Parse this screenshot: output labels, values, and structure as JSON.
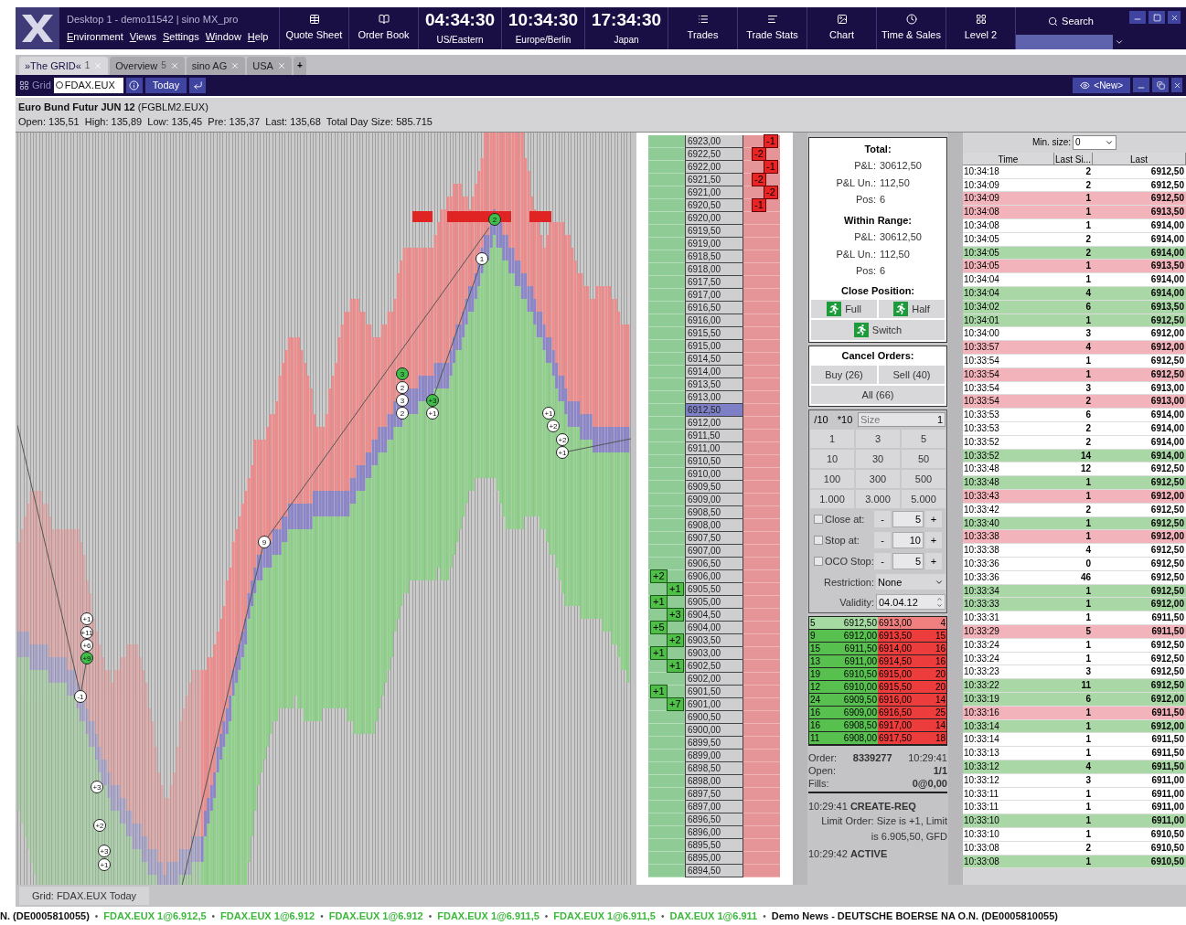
{
  "app": {
    "title": "Desktop 1 - demo11542 | sino MX_pro",
    "menu": [
      "Environment",
      "Views",
      "Settings",
      "Window",
      "Help"
    ]
  },
  "tools_left": [
    {
      "label": "Quote Sheet",
      "kind": "quote"
    },
    {
      "label": "Order Book",
      "kind": "book"
    }
  ],
  "clocks": [
    {
      "time": "04:34:30",
      "zone": "US/Eastern"
    },
    {
      "time": "10:34:30",
      "zone": "Europe/Berlin"
    },
    {
      "time": "17:34:30",
      "zone": "Japan"
    }
  ],
  "tools_right": [
    {
      "label": "Trades",
      "kind": "trades"
    },
    {
      "label": "Trade Stats",
      "kind": "stats"
    },
    {
      "label": "Chart",
      "kind": "chart"
    },
    {
      "label": "Time & Sales",
      "kind": "times"
    },
    {
      "label": "Level 2",
      "kind": "level2"
    }
  ],
  "search": {
    "label": "Search"
  },
  "tabs": [
    {
      "label": "»The GRID«",
      "count": "1",
      "selected": true
    },
    {
      "label": "Overview",
      "count": "5",
      "selected": false
    },
    {
      "label": "sino AG",
      "selected": false
    },
    {
      "label": "USA",
      "selected": false
    }
  ],
  "add_tab": "+",
  "grid_toolbar": {
    "label": "Grid",
    "symbol": "FDAX.EUX",
    "date": "Today",
    "view": "<New>"
  },
  "instrument": {
    "title": "**Euro Bund Futur JUN 12** (FGBLM2.EUX)",
    "stats": "Open: 135,51  High: 135,89  Low: 135,45  Pre: 135,37  Last: 135,68  Total Day Size: 585.715"
  },
  "chart_markers": [
    {
      "label": "2",
      "filled": true
    },
    {
      "label": "1",
      "filled": false
    },
    {
      "label": "3",
      "filled": true
    },
    {
      "label": "2",
      "filled": false
    },
    {
      "label": "3",
      "filled": false
    },
    {
      "label": "2",
      "filled": false
    },
    {
      "label": "+3",
      "filled": true
    },
    {
      "label": "+1",
      "filled": false
    },
    {
      "label": "+1",
      "filled": false
    },
    {
      "label": "+2",
      "filled": false
    },
    {
      "label": "+2",
      "filled": false
    },
    {
      "label": "+1",
      "filled": false
    },
    {
      "label": "9",
      "filled": false
    },
    {
      "label": "+1",
      "filled": false
    },
    {
      "label": "+11",
      "filled": false
    },
    {
      "label": "+6",
      "filled": false
    },
    {
      "label": "+9",
      "filled": true
    },
    {
      "label": "-1",
      "filled": false
    },
    {
      "label": "+3",
      "filled": false
    },
    {
      "label": "+2",
      "filled": false
    },
    {
      "label": "+3",
      "filled": false
    },
    {
      "label": "+1",
      "filled": false
    }
  ],
  "ladder": [
    {
      "price": "6923,00",
      "selected": false,
      "order": {
        "label": "-1",
        "kind": "sell"
      }
    },
    {
      "price": "6922,50",
      "selected": false,
      "order": {
        "label": "-2",
        "kind": "sell"
      }
    },
    {
      "price": "6922,00",
      "selected": false,
      "order": {
        "label": "-1",
        "kind": "sell"
      }
    },
    {
      "price": "6921,50",
      "selected": false,
      "order": {
        "label": "-2",
        "kind": "sell"
      }
    },
    {
      "price": "6921,00",
      "selected": false,
      "order": {
        "label": "-2",
        "kind": "sell"
      }
    },
    {
      "price": "6920,50",
      "selected": false,
      "order": {
        "label": "-1",
        "kind": "sell"
      }
    },
    {
      "price": "6920,00",
      "selected": false
    },
    {
      "price": "6919,50",
      "selected": false
    },
    {
      "price": "6919,00",
      "selected": false
    },
    {
      "price": "6918,50",
      "selected": false
    },
    {
      "price": "6918,00",
      "selected": false
    },
    {
      "price": "6917,50",
      "selected": false
    },
    {
      "price": "6917,00",
      "selected": false
    },
    {
      "price": "6916,50",
      "selected": false
    },
    {
      "price": "6916,00",
      "selected": false
    },
    {
      "price": "6915,50",
      "selected": false
    },
    {
      "price": "6915,00",
      "selected": false
    },
    {
      "price": "6914,50",
      "selected": false
    },
    {
      "price": "6914,00",
      "selected": false
    },
    {
      "price": "6913,50",
      "selected": false
    },
    {
      "price": "6913,00",
      "selected": false
    },
    {
      "price": "6912,50",
      "selected": true
    },
    {
      "price": "6912,00",
      "selected": false
    },
    {
      "price": "6911,50",
      "selected": false
    },
    {
      "price": "6911,00",
      "selected": false
    },
    {
      "price": "6910,50",
      "selected": false
    },
    {
      "price": "6910,00",
      "selected": false
    },
    {
      "price": "6909,50",
      "selected": false
    },
    {
      "price": "6909,00",
      "selected": false
    },
    {
      "price": "6908,50",
      "selected": false
    },
    {
      "price": "6908,00",
      "selected": false
    },
    {
      "price": "6907,50",
      "selected": false
    },
    {
      "price": "6907,00",
      "selected": false
    },
    {
      "price": "6906,50",
      "selected": false
    },
    {
      "price": "6906,00",
      "selected": false,
      "order": {
        "label": "+2",
        "kind": "buy"
      }
    },
    {
      "price": "6905,50",
      "selected": false,
      "order": {
        "label": "+1",
        "kind": "buy"
      }
    },
    {
      "price": "6905,00",
      "selected": false,
      "order": {
        "label": "+1",
        "kind": "buy"
      }
    },
    {
      "price": "6904,50",
      "selected": false,
      "order": {
        "label": "+3",
        "kind": "buy"
      }
    },
    {
      "price": "6904,00",
      "selected": false,
      "order": {
        "label": "+5",
        "kind": "buy"
      }
    },
    {
      "price": "6903,50",
      "selected": false,
      "order": {
        "label": "+2",
        "kind": "buy"
      }
    },
    {
      "price": "6903,00",
      "selected": false,
      "order": {
        "label": "+1",
        "kind": "buy"
      }
    },
    {
      "price": "6902,50",
      "selected": false,
      "order": {
        "label": "+1",
        "kind": "buy"
      }
    },
    {
      "price": "6902,00",
      "selected": false
    },
    {
      "price": "6901,50",
      "selected": false,
      "order": {
        "label": "+1",
        "kind": "buy"
      }
    },
    {
      "price": "6901,00",
      "selected": false,
      "order": {
        "label": "+7",
        "kind": "buy"
      }
    },
    {
      "price": "6900,50",
      "selected": false
    },
    {
      "price": "6900,00",
      "selected": false
    },
    {
      "price": "6899,50",
      "selected": false
    },
    {
      "price": "6899,00",
      "selected": false
    },
    {
      "price": "6898,50",
      "selected": false
    },
    {
      "price": "6898,00",
      "selected": false
    },
    {
      "price": "6897,50",
      "selected": false
    },
    {
      "price": "6897,00",
      "selected": false
    },
    {
      "price": "6896,50",
      "selected": false
    },
    {
      "price": "6896,00",
      "selected": false
    },
    {
      "price": "6895,50",
      "selected": false
    },
    {
      "price": "6895,00",
      "selected": false
    },
    {
      "price": "6894,50",
      "selected": false
    }
  ],
  "position": {
    "total_title": "Total:",
    "total": [
      {
        "label": "P&L:",
        "value": "30612,50"
      },
      {
        "label": "P&L Un.:",
        "value": "112,50"
      },
      {
        "label": "Pos:",
        "value": "6"
      }
    ],
    "range_title": "Within Range:",
    "range": [
      {
        "label": "P&L:",
        "value": "30612,50"
      },
      {
        "label": "P&L Un.:",
        "value": "112,50"
      },
      {
        "label": "Pos:",
        "value": "6"
      }
    ]
  },
  "close_position": {
    "title": "Close Position:",
    "buttons": [
      "Full",
      "Half",
      "Switch"
    ]
  },
  "cancel_orders": {
    "title": "Cancel Orders:",
    "buttons": [
      "Buy (26)",
      "Sell (40)",
      "All (66)"
    ]
  },
  "quantity": {
    "divide": "/10",
    "multiply": "*10",
    "placeholder": "Size",
    "value": "1",
    "presets": [
      "1",
      "3",
      "5",
      "10",
      "30",
      "50",
      "100",
      "300",
      "500",
      "1.000",
      "3.000",
      "5.000"
    ]
  },
  "brackets": [
    {
      "label": "Close at:",
      "value": "5",
      "checked": false
    },
    {
      "label": "Stop at:",
      "value": "10",
      "checked": false
    },
    {
      "label": "OCO Stop:",
      "value": "5",
      "checked": false
    }
  ],
  "stepper": {
    "minus": "-",
    "plus": "+"
  },
  "restriction": {
    "label": "Restriction:",
    "value": "None"
  },
  "validity": {
    "label": "Validity:",
    "value": "04.04.12"
  },
  "level2": [
    {
      "bid_qty": "5",
      "bid": "6912,50",
      "ask": "6913,00",
      "ask_qty": "4",
      "best": true
    },
    {
      "bid_qty": "9",
      "bid": "6912,00",
      "ask": "6913,50",
      "ask_qty": "15",
      "best": false
    },
    {
      "bid_qty": "15",
      "bid": "6911,50",
      "ask": "6914,00",
      "ask_qty": "16",
      "best": false
    },
    {
      "bid_qty": "13",
      "bid": "6911,00",
      "ask": "6914,50",
      "ask_qty": "16",
      "best": false
    },
    {
      "bid_qty": "19",
      "bid": "6910,50",
      "ask": "6915,00",
      "ask_qty": "20",
      "best": false
    },
    {
      "bid_qty": "12",
      "bid": "6910,00",
      "ask": "6915,50",
      "ask_qty": "20",
      "best": false
    },
    {
      "bid_qty": "24",
      "bid": "6909,50",
      "ask": "6916,00",
      "ask_qty": "14",
      "best": false
    },
    {
      "bid_qty": "16",
      "bid": "6909,00",
      "ask": "6916,50",
      "ask_qty": "25",
      "best": false
    },
    {
      "bid_qty": "16",
      "bid": "6908,50",
      "ask": "6917,00",
      "ask_qty": "14",
      "best": false
    },
    {
      "bid_qty": "11",
      "bid": "6908,00",
      "ask": "6917,50",
      "ask_qty": "18",
      "best": false
    }
  ],
  "order": {
    "rows": [
      {
        "label": "Order:",
        "value": "8339277",
        "time": "10:29:41"
      },
      {
        "label": "Open:",
        "value": "1/1"
      },
      {
        "label": "Fills:",
        "value": "0@0,00"
      }
    ],
    "log": [
      {
        "time": "10:29:41",
        "event": "CREATE-REQ",
        "detail": "Limit Order: Size is +1, Limit is 6.905,50, GFD"
      },
      {
        "time": "10:29:42",
        "event": "ACTIVE"
      }
    ]
  },
  "time_sales": {
    "min_qty_label": "Min. size:",
    "min_qty": "0",
    "columns": [
      "Time",
      "Last Si...",
      "Last"
    ],
    "rows": [
      {
        "time": "10:34:18",
        "qty": "2",
        "last": "6912,50",
        "kind": "none"
      },
      {
        "time": "10:34:09",
        "qty": "2",
        "last": "6912,50",
        "kind": "none"
      },
      {
        "time": "10:34:09",
        "qty": "1",
        "last": "6912,50",
        "kind": "sell"
      },
      {
        "time": "10:34:08",
        "qty": "1",
        "last": "6913,50",
        "kind": "sell"
      },
      {
        "time": "10:34:08",
        "qty": "1",
        "last": "6914,00",
        "kind": "none"
      },
      {
        "time": "10:34:05",
        "qty": "2",
        "last": "6914,00",
        "kind": "none"
      },
      {
        "time": "10:34:05",
        "qty": "2",
        "last": "6914,00",
        "kind": "buy"
      },
      {
        "time": "10:34:05",
        "qty": "1",
        "last": "6913,50",
        "kind": "sell"
      },
      {
        "time": "10:34:04",
        "qty": "1",
        "last": "6914,00",
        "kind": "none"
      },
      {
        "time": "10:34:04",
        "qty": "4",
        "last": "6914,00",
        "kind": "buy"
      },
      {
        "time": "10:34:02",
        "qty": "6",
        "last": "6913,50",
        "kind": "buy"
      },
      {
        "time": "10:34:01",
        "qty": "1",
        "last": "6912,50",
        "kind": "buy"
      },
      {
        "time": "10:34:00",
        "qty": "3",
        "last": "6912,00",
        "kind": "none"
      },
      {
        "time": "10:33:57",
        "qty": "4",
        "last": "6912,00",
        "kind": "sell"
      },
      {
        "time": "10:33:54",
        "qty": "1",
        "last": "6912,50",
        "kind": "none"
      },
      {
        "time": "10:33:54",
        "qty": "1",
        "last": "6912,50",
        "kind": "sell"
      },
      {
        "time": "10:33:54",
        "qty": "3",
        "last": "6913,00",
        "kind": "none"
      },
      {
        "time": "10:33:54",
        "qty": "2",
        "last": "6913,00",
        "kind": "sell"
      },
      {
        "time": "10:33:53",
        "qty": "6",
        "last": "6914,00",
        "kind": "none"
      },
      {
        "time": "10:33:53",
        "qty": "2",
        "last": "6914,00",
        "kind": "none"
      },
      {
        "time": "10:33:52",
        "qty": "2",
        "last": "6914,00",
        "kind": "none"
      },
      {
        "time": "10:33:52",
        "qty": "14",
        "last": "6914,00",
        "kind": "buy"
      },
      {
        "time": "10:33:48",
        "qty": "12",
        "last": "6912,50",
        "kind": "none"
      },
      {
        "time": "10:33:48",
        "qty": "1",
        "last": "6912,50",
        "kind": "buy"
      },
      {
        "time": "10:33:43",
        "qty": "1",
        "last": "6912,00",
        "kind": "sell"
      },
      {
        "time": "10:33:42",
        "qty": "2",
        "last": "6912,50",
        "kind": "none"
      },
      {
        "time": "10:33:40",
        "qty": "1",
        "last": "6912,50",
        "kind": "buy"
      },
      {
        "time": "10:33:38",
        "qty": "1",
        "last": "6912,00",
        "kind": "sell"
      },
      {
        "time": "10:33:38",
        "qty": "4",
        "last": "6912,50",
        "kind": "none"
      },
      {
        "time": "10:33:36",
        "qty": "0",
        "last": "6912,50",
        "kind": "none"
      },
      {
        "time": "10:33:36",
        "qty": "46",
        "last": "6912,50",
        "kind": "none"
      },
      {
        "time": "10:33:34",
        "qty": "1",
        "last": "6912,50",
        "kind": "buy"
      },
      {
        "time": "10:33:33",
        "qty": "1",
        "last": "6912,00",
        "kind": "buy"
      },
      {
        "time": "10:33:31",
        "qty": "1",
        "last": "6911,50",
        "kind": "none"
      },
      {
        "time": "10:33:29",
        "qty": "5",
        "last": "6911,50",
        "kind": "sell"
      },
      {
        "time": "10:33:24",
        "qty": "1",
        "last": "6912,50",
        "kind": "none"
      },
      {
        "time": "10:33:24",
        "qty": "1",
        "last": "6912,50",
        "kind": "none"
      },
      {
        "time": "10:33:23",
        "qty": "3",
        "last": "6912,50",
        "kind": "none"
      },
      {
        "time": "10:33:22",
        "qty": "11",
        "last": "6912,50",
        "kind": "buy"
      },
      {
        "time": "10:33:19",
        "qty": "6",
        "last": "6912,00",
        "kind": "buy"
      },
      {
        "time": "10:33:16",
        "qty": "1",
        "last": "6911,50",
        "kind": "sell"
      },
      {
        "time": "10:33:14",
        "qty": "1",
        "last": "6912,00",
        "kind": "buy"
      },
      {
        "time": "10:33:14",
        "qty": "1",
        "last": "6911,50",
        "kind": "none"
      },
      {
        "time": "10:33:13",
        "qty": "1",
        "last": "6911,50",
        "kind": "none"
      },
      {
        "time": "10:33:12",
        "qty": "4",
        "last": "6911,50",
        "kind": "buy"
      },
      {
        "time": "10:33:12",
        "qty": "3",
        "last": "6911,00",
        "kind": "none"
      },
      {
        "time": "10:33:11",
        "qty": "1",
        "last": "6911,00",
        "kind": "none"
      },
      {
        "time": "10:33:11",
        "qty": "1",
        "last": "6911,00",
        "kind": "none"
      },
      {
        "time": "10:33:10",
        "qty": "1",
        "last": "6911,00",
        "kind": "buy"
      },
      {
        "time": "10:33:10",
        "qty": "1",
        "last": "6910,50",
        "kind": "none"
      },
      {
        "time": "10:33:08",
        "qty": "2",
        "last": "6910,50",
        "kind": "none"
      },
      {
        "time": "10:33:08",
        "qty": "1",
        "last": "6910,50",
        "kind": "buy"
      }
    ]
  },
  "bottom_tab": "Grid: FDAX.EUX Today",
  "ticker": {
    "separator": "•",
    "items": [
      {
        "text": "N. (DE0005810055)",
        "kind": "news"
      },
      {
        "text": "FDAX.EUX 1@6.912,5",
        "kind": "trade"
      },
      {
        "text": "FDAX.EUX 1@6.912",
        "kind": "trade"
      },
      {
        "text": "FDAX.EUX 1@6.912",
        "kind": "trade"
      },
      {
        "text": "FDAX.EUX 1@6.911,5",
        "kind": "trade"
      },
      {
        "text": "FDAX.EUX 1@6.911,5",
        "kind": "trade"
      },
      {
        "text": "DAX.EUX 1@6.911",
        "kind": "trade"
      },
      {
        "text": "Demo News - DEUTSCHE BOERSE NA O.N. (DE0005810055)",
        "kind": "news"
      }
    ]
  }
}
